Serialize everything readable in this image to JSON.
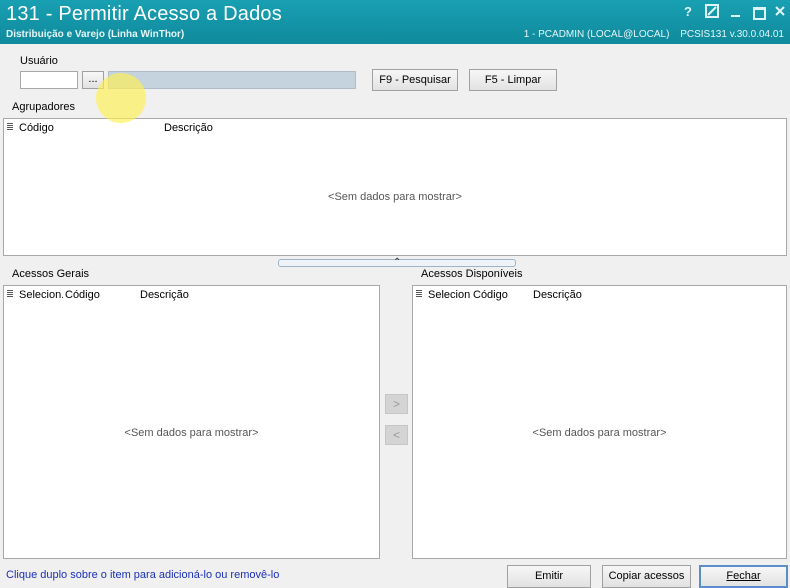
{
  "window": {
    "title": "131 - Permitir Acesso a Dados",
    "subtitle": "Distribuição e Varejo (Linha WinThor)",
    "user_info": "1 - PCADMIN (LOCAL@LOCAL)",
    "version_info": "PCSIS131  v.30.0.04.01",
    "controls": {
      "help": "?"
    }
  },
  "usuario": {
    "label": "Usuário",
    "code_value": "",
    "browse_label": "...",
    "name_value": "",
    "search_button": "F9 - Pesquisar",
    "clear_button": "F5 - Limpar"
  },
  "agrupadores": {
    "label": "Agrupadores",
    "columns": [
      "Código",
      "Descrição"
    ],
    "empty_text": "<Sem dados para mostrar>"
  },
  "acessos_gerais": {
    "label": "Acessos Gerais",
    "columns": [
      "Selecion.",
      "Código",
      "Descrição"
    ],
    "empty_text": "<Sem dados para mostrar>"
  },
  "acessos_disponiveis": {
    "label": "Acessos Disponíveis",
    "columns": [
      "Selecion",
      "Código",
      "Descrição"
    ],
    "empty_text": "<Sem dados para mostrar>"
  },
  "transfer": {
    "add": ">",
    "remove": "<"
  },
  "footer": {
    "hint": "Clique duplo sobre o item para adicioná-lo ou removê-lo",
    "emit_button": "Emitir",
    "copy_button": "Copiar acessos",
    "close_button": "Fechar"
  }
}
